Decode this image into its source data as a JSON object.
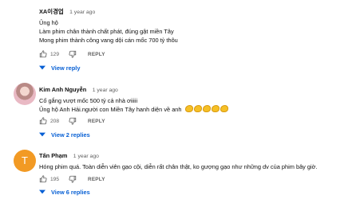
{
  "comments": [
    {
      "author": "XA이경업",
      "time": "1 year ago",
      "lines": [
        "Ủng hộ",
        "Làm phim chân thành chất phát, đúng gật miền Tây",
        "Mong phim thành công vang dội cán mốc 700 tỷ  thôu"
      ],
      "likes": "129",
      "reply_label": "REPLY",
      "view_replies": "View reply"
    },
    {
      "author": "Kim Anh Nguyễn",
      "time": "1 year ago",
      "lines": [
        "Cố gắng vượt mốc 500 tỷ cả nhà ơiiiii",
        "Ủng hộ Anh Hải.người con Miền Tây hanh diện về anh"
      ],
      "emoji_name": "flexed-biceps",
      "emoji_count": 5,
      "likes": "208",
      "reply_label": "REPLY",
      "view_replies": "View 2 replies"
    },
    {
      "author": "Tấn Phạm",
      "avatar_letter": "T",
      "avatar_color": "#f29a24",
      "time": "1 year ago",
      "lines": [
        "Hóng phim quá. Toàn diễn viên gạo cội, diễn rất chân thật, ko gượng gạo như những dv của phim bây giờ."
      ],
      "likes": "195",
      "reply_label": "REPLY",
      "view_replies": "View 6 replies"
    }
  ],
  "colors": {
    "link": "#065fd4",
    "meta": "#606060",
    "text": "#0f0f0f"
  }
}
